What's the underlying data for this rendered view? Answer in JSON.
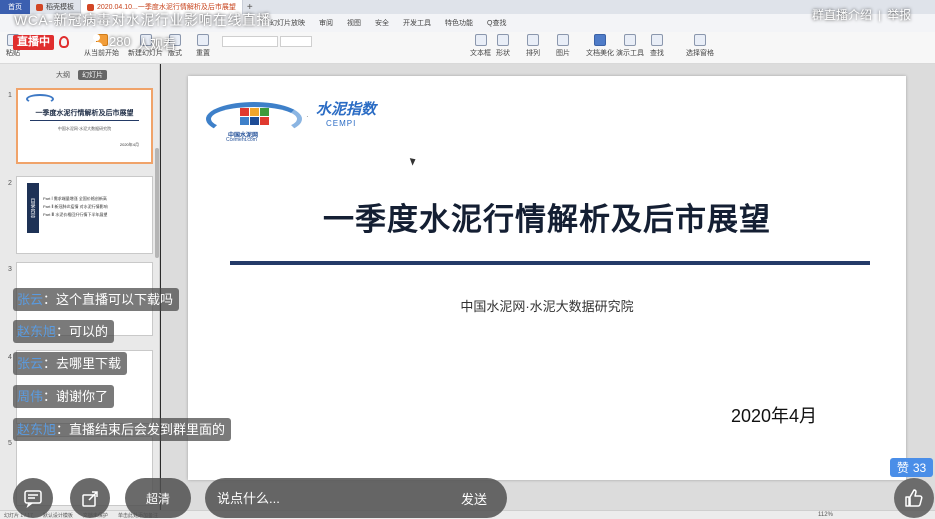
{
  "wps": {
    "home_tab": "首页",
    "tabs": [
      {
        "label": "稻壳模板"
      },
      {
        "label": "2020.04.10...一季度水泥行情解析及后市展望"
      }
    ],
    "menu": [
      "幻灯片放映",
      "审阅",
      "视图",
      "安全",
      "开发工具",
      "特色功能",
      "Q查找"
    ],
    "ribbon": {
      "paste": "粘贴",
      "from_current": "从当前开始",
      "new_slide": "新建幻灯片",
      "layout": "版式",
      "reset": "重置",
      "textbox": "文本框",
      "shape": "形状",
      "arrange": "排列",
      "picture": "图片",
      "fill": "填充",
      "outline": "轮廓",
      "doc_beautify": "文档美化",
      "presenter": "演示工具",
      "find": "查找",
      "replace": "替换",
      "select_pane": "选择窗格"
    },
    "panel_tabs": {
      "outline": "大纲",
      "slides": "幻灯片"
    },
    "thumb1": {
      "num": "1",
      "title": "一季度水泥行情解析及后市展望",
      "sub": "中国水泥网·水泥大数据研究院",
      "date": "2020年4月"
    },
    "thumb2": {
      "num": "2",
      "bar": "目录内容",
      "rows": [
        "Part Ⅰ  需求端量增涨 全国价格创新高",
        "Part Ⅱ  新冠肺炎疫情  对水泥行情影响",
        "Part Ⅲ  水泥价格回升行情下半年展望"
      ]
    },
    "thumb3": {
      "num": "3"
    },
    "thumb4": {
      "num": "4"
    },
    "thumb5": {
      "num": "5"
    },
    "status": {
      "slide_info": "幻灯片 1 / 17",
      "theme": "默认设计模板",
      "font_missing": "文档未保护",
      "remark": "单击此处添加备注",
      "zoom": "112%"
    }
  },
  "slide": {
    "title": "一季度水泥行情解析及后市展望",
    "subtitle": "中国水泥网·水泥大数据研究院",
    "date": "2020年4月",
    "logo_cement_cn": "中国水泥网",
    "logo_cement_en": "Ccement.com",
    "logo_cempi_cn": "水泥指数",
    "logo_cempi_en": "CEMPI"
  },
  "stream": {
    "title": "WCA-新冠病毒对水泥行业影响在线直播",
    "group_intro": "群直播介绍",
    "report": "举报",
    "live_badge": "直播中",
    "viewer_count": "280",
    "viewer_label": "人观看",
    "comments": [
      {
        "user": "张云",
        "text": "：这个直播可以下载吗"
      },
      {
        "user": "赵东旭",
        "text": "：可以的"
      },
      {
        "user": "张云",
        "text": "：去哪里下载"
      },
      {
        "user": "周伟",
        "text": "：谢谢你了"
      },
      {
        "user": "赵东旭",
        "text": "：直播结束后会发到群里面的"
      }
    ],
    "like_label": "赞",
    "like_count": "33",
    "quality": "超清",
    "chat_placeholder": "说点什么...",
    "send": "发送"
  },
  "colors": {
    "live_red": "#e02e2e",
    "user_blue": "#5a9be0",
    "like_blue": "#4a8ee8",
    "slide_rule": "#243a68"
  }
}
